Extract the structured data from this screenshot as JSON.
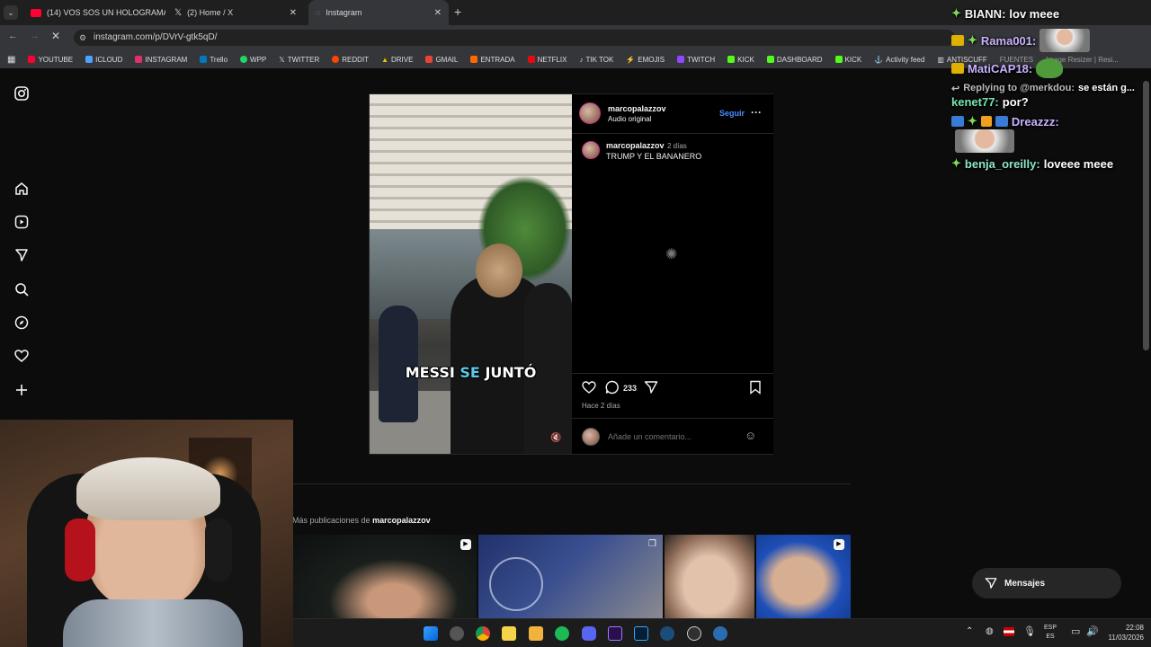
{
  "browser": {
    "tabs": [
      {
        "label": "(14) VOS SOS UN HOLOGRAMA",
        "favicon_color": "#ff0033"
      },
      {
        "label": "(2) Home / X",
        "favicon_color": "#ffffff"
      },
      {
        "label": "Instagram",
        "favicon_color": "#bbbbbb"
      }
    ],
    "url": "instagram.com/p/DVrV-gtk5qD/",
    "bookmarks": [
      {
        "label": "YOUTUBE",
        "color": "#ff0033"
      },
      {
        "label": "ICLOUD",
        "color": "#4da3ff"
      },
      {
        "label": "INSTAGRAM",
        "color": "#e1306c"
      },
      {
        "label": "Trello",
        "color": "#0079bf"
      },
      {
        "label": "WPP",
        "color": "#25d366"
      },
      {
        "label": "TWITTER",
        "color": "#ffffff"
      },
      {
        "label": "REDDIT",
        "color": "#ff4500"
      },
      {
        "label": "DRIVE",
        "color": "#fbbc04"
      },
      {
        "label": "GMAIL",
        "color": "#ea4335"
      },
      {
        "label": "ENTRADA",
        "color": "#ff6a00"
      },
      {
        "label": "NETFLIX",
        "color": "#e50914"
      },
      {
        "label": "TIK TOK",
        "color": "#ffffff"
      },
      {
        "label": "EMOJIS",
        "color": "#ff4d4d"
      },
      {
        "label": "TWITCH",
        "color": "#9146ff"
      },
      {
        "label": "KICK",
        "color": "#53fc18"
      },
      {
        "label": "DASHBOARD",
        "color": "#53fc18"
      },
      {
        "label": "KICK",
        "color": "#53fc18"
      },
      {
        "label": "Activity feed",
        "color": "#dddddd"
      },
      {
        "label": "ANTISCUFF",
        "color": "#dddddd"
      },
      {
        "label": "FUENTES",
        "color": "#888888"
      },
      {
        "label": "Image Resizer | Resi...",
        "color": "#4da3ff"
      }
    ]
  },
  "instagram": {
    "nav_icons": [
      "instagram-logo-icon",
      "home-icon",
      "reels-icon",
      "send-icon",
      "search-icon",
      "explore-icon",
      "heart-icon",
      "create-icon"
    ],
    "post": {
      "username": "marcopalazzov",
      "audio": "Audio original",
      "follow": "Seguir",
      "more": "···",
      "caption_user": "marcopalazzov",
      "caption_time": "2 días",
      "caption": "TRUMP Y EL BANANERO",
      "comments_count": "233",
      "posted_ago": "Hace 2 días",
      "comment_placeholder": "Añade un comentario...",
      "video_caption_a": "MESSI",
      "video_caption_b": "SE",
      "video_caption_c": "JUNTÓ",
      "video_caption_highlight_color": "#5ec8e6"
    },
    "more_posts_prefix": "Más publicaciones de",
    "more_posts_user": "marcopalazzov",
    "messages_button": "Mensajes"
  },
  "chat": [
    {
      "user": "BIANN:",
      "text": "lov meee",
      "color": "#f5f5f5"
    },
    {
      "user": "Rama001:",
      "text": "",
      "color": "#c9b3ff"
    },
    {
      "user": "MatiCAP18:",
      "text": "",
      "color": "#c9b3ff"
    },
    {
      "user": "Replying to @merkdou:",
      "text": "se están g...",
      "color": "#bbbbbb"
    },
    {
      "user": "kenet77:",
      "text": "por?",
      "color": "#78e6b0"
    },
    {
      "user": "Dreazzz:",
      "text": "",
      "color": "#c9b3ff"
    },
    {
      "user": "benja_oreilly:",
      "text": "loveee meee",
      "color": "#8ee6c8"
    }
  ],
  "taskbar": {
    "lang_top": "ESP",
    "lang_bottom": "ES",
    "time": "22:08",
    "date": "11/03/2026"
  }
}
